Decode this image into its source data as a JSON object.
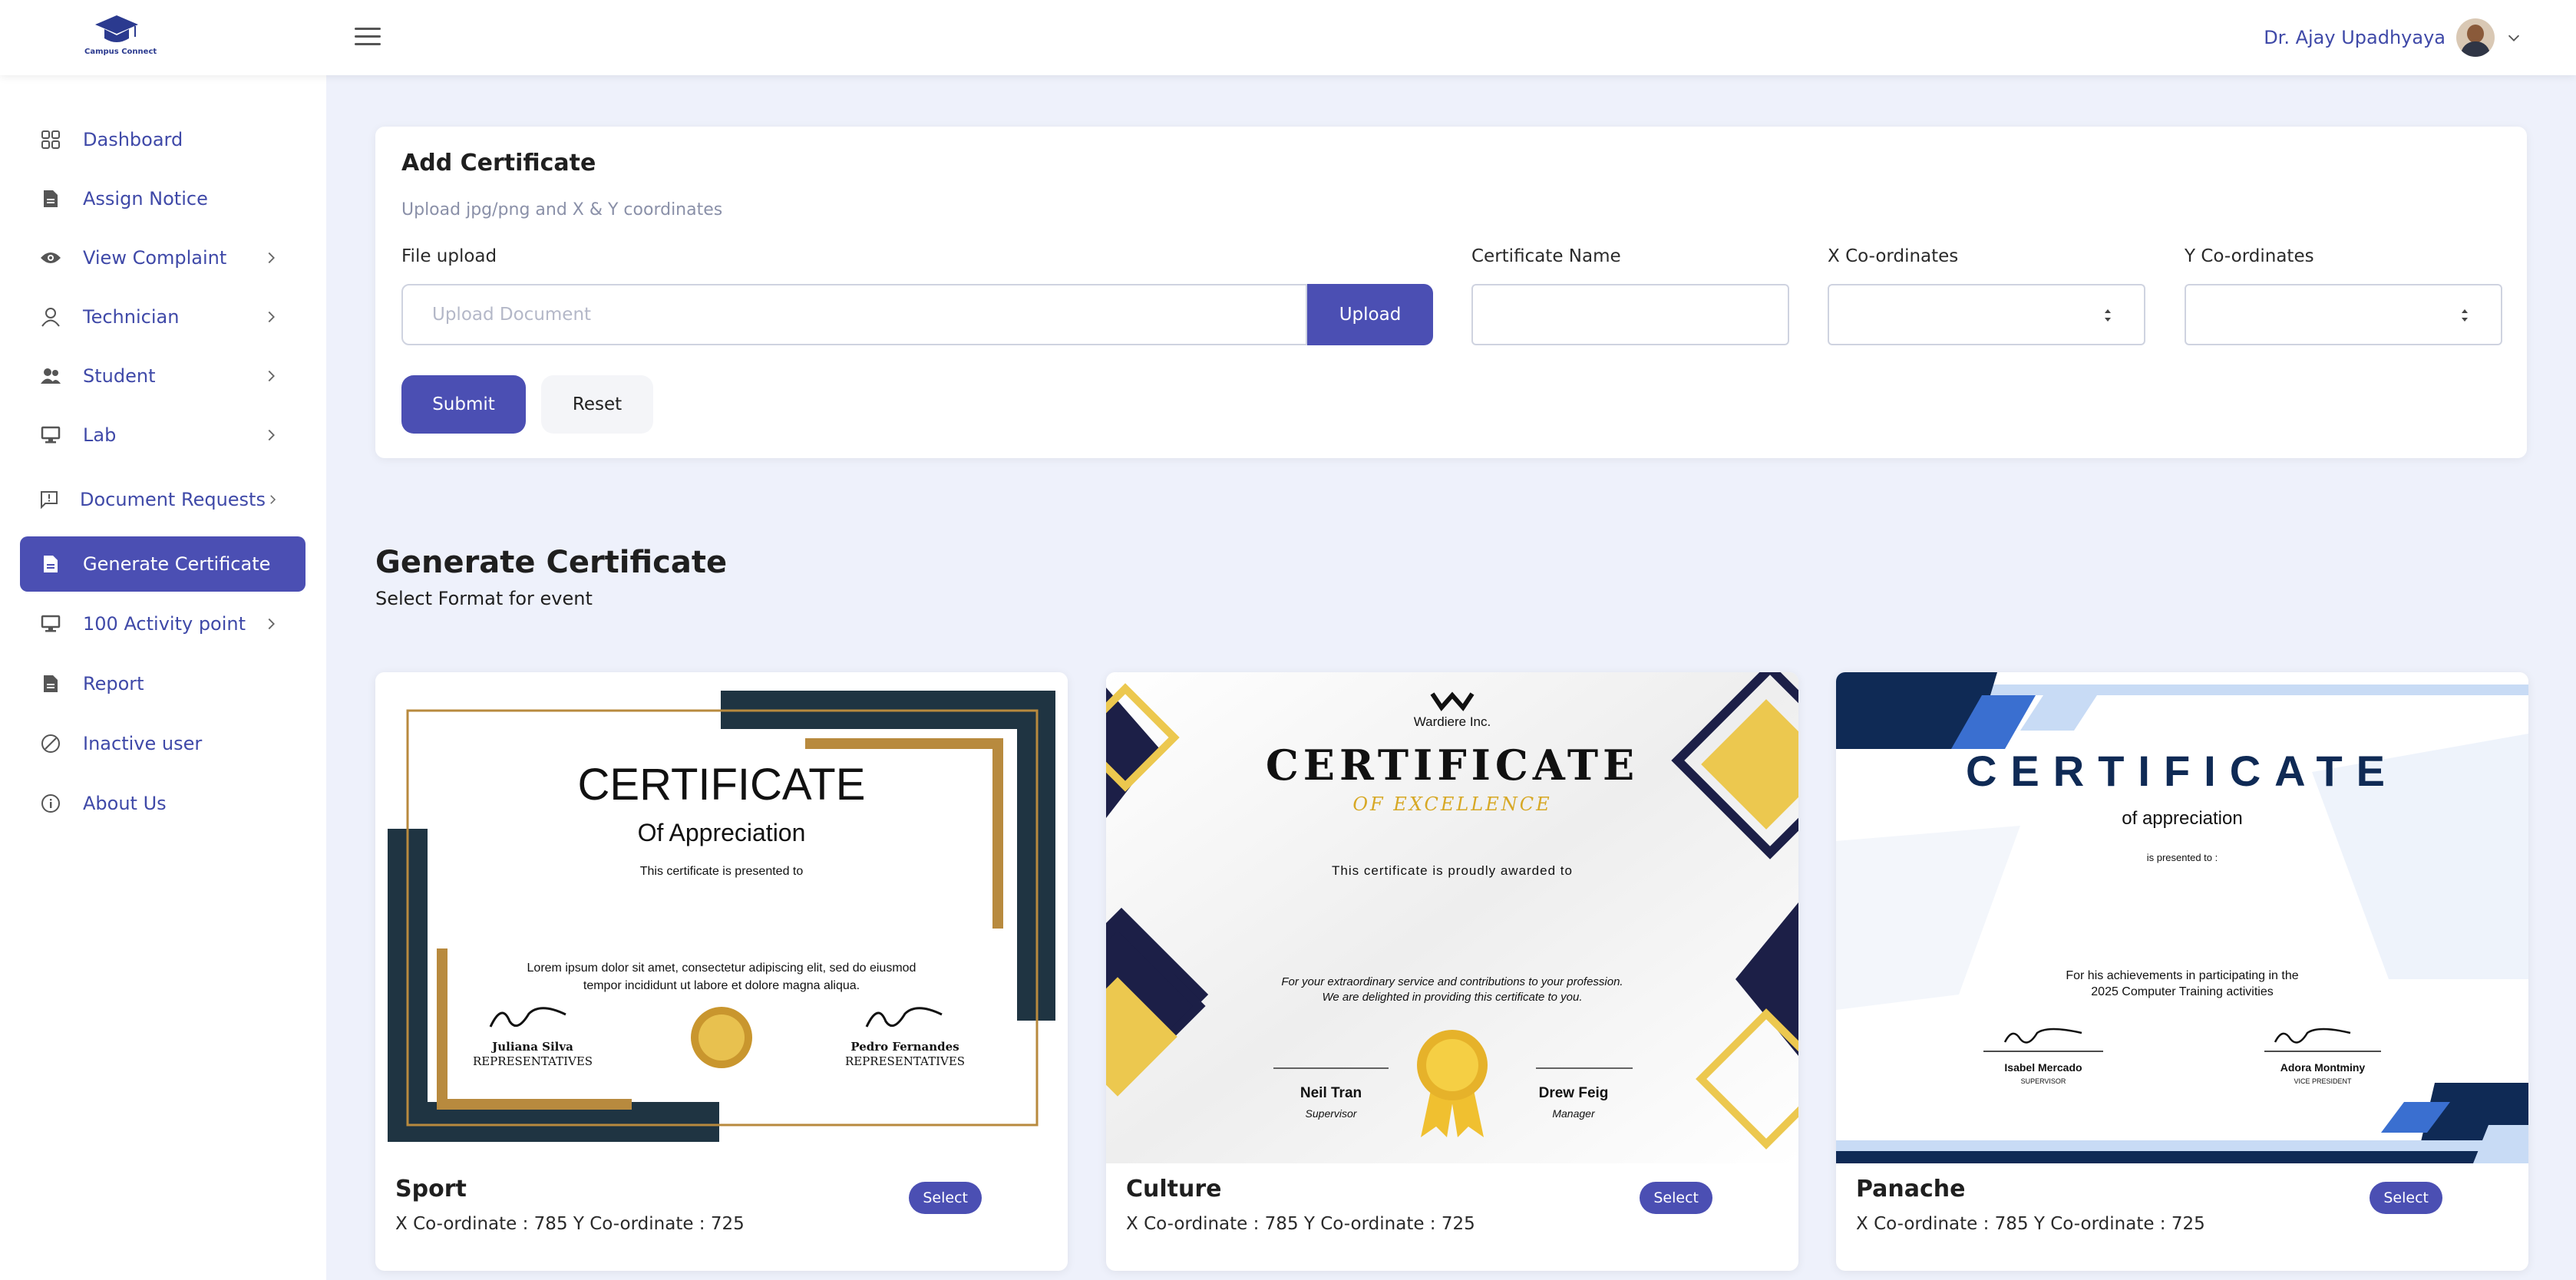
{
  "header": {
    "logo_text": "Campus Connect",
    "user_name": "Dr. Ajay Upadhyaya"
  },
  "sidebar": {
    "items": [
      {
        "label": "Dashboard",
        "icon": "grid-icon",
        "has_arrow": false,
        "active": false
      },
      {
        "label": "Assign Notice",
        "icon": "document-icon",
        "has_arrow": false,
        "active": false
      },
      {
        "label": "View Complaint",
        "icon": "eye-icon",
        "has_arrow": true,
        "active": false
      },
      {
        "label": "Technician",
        "icon": "user-icon",
        "has_arrow": true,
        "active": false
      },
      {
        "label": "Student",
        "icon": "users-icon",
        "has_arrow": true,
        "active": false
      },
      {
        "label": "Lab",
        "icon": "monitor-icon",
        "has_arrow": true,
        "active": false
      },
      {
        "label": "Document Requests",
        "icon": "chat-alert-icon",
        "has_arrow": true,
        "active": false
      },
      {
        "label": "Generate Certificate",
        "icon": "document-icon",
        "has_arrow": false,
        "active": true
      },
      {
        "label": "100 Activity point",
        "icon": "monitor-icon",
        "has_arrow": true,
        "active": false
      },
      {
        "label": "Report",
        "icon": "document-icon",
        "has_arrow": false,
        "active": false
      },
      {
        "label": "Inactive user",
        "icon": "block-icon",
        "has_arrow": false,
        "active": false
      },
      {
        "label": "About Us",
        "icon": "info-icon",
        "has_arrow": false,
        "active": false
      }
    ]
  },
  "add_certificate": {
    "title": "Add Certificate",
    "subtitle": "Upload jpg/png and X & Y coordinates",
    "file_upload_label": "File upload",
    "file_placeholder": "Upload Document",
    "upload_button": "Upload",
    "cert_name_label": "Certificate Name",
    "x_label": "X Co-ordinates",
    "y_label": "Y Co-ordinates",
    "submit_button": "Submit",
    "reset_button": "Reset"
  },
  "generate": {
    "title": "Generate Certificate",
    "subtitle": "Select Format for event",
    "select_label": "Select",
    "templates": [
      {
        "name": "Sport",
        "coords": "X Co-ordinate : 785 Y Co-ordinate : 725",
        "cert_title": "CERTIFICATE",
        "cert_sub": "Of Appreciation",
        "presented": "This certificate is presented to",
        "body1": "Lorem ipsum dolor sit amet, consectetur adipiscing elit, sed do eiusmod",
        "body2": "tempor incididunt ut labore et dolore magna aliqua.",
        "sig1_name": "Juliana Silva",
        "sig1_role": "REPRESENTATIVES",
        "sig2_name": "Pedro Fernandes",
        "sig2_role": "REPRESENTATIVES"
      },
      {
        "name": "Culture",
        "coords": "X Co-ordinate : 785 Y Co-ordinate : 725",
        "company": "Wardiere Inc.",
        "cert_title": "CERTIFICATE",
        "cert_sub": "OF EXCELLENCE",
        "presented": "This certificate is proudly awarded to",
        "body1": "For your extraordinary service and contributions to your profession.",
        "body2": "We are delighted in providing this certificate to you.",
        "sig1_name": "Neil Tran",
        "sig1_role": "Supervisor",
        "sig2_name": "Drew Feig",
        "sig2_role": "Manager"
      },
      {
        "name": "Panache",
        "coords": "X Co-ordinate : 785 Y Co-ordinate : 725",
        "cert_title": "CERTIFICATE",
        "cert_sub": "of appreciation",
        "presented": "is presented to :",
        "body1": "For his achievements in participating in the",
        "body2": "2025 Computer Training activities",
        "sig1_name": "Isabel Mercado",
        "sig1_role": "SUPERVISOR",
        "sig2_name": "Adora Montminy",
        "sig2_role": "VICE PRESIDENT"
      }
    ]
  },
  "colors": {
    "accent": "#4b4fb3",
    "nav_text": "#3f49a8",
    "background": "#eef1fb"
  }
}
